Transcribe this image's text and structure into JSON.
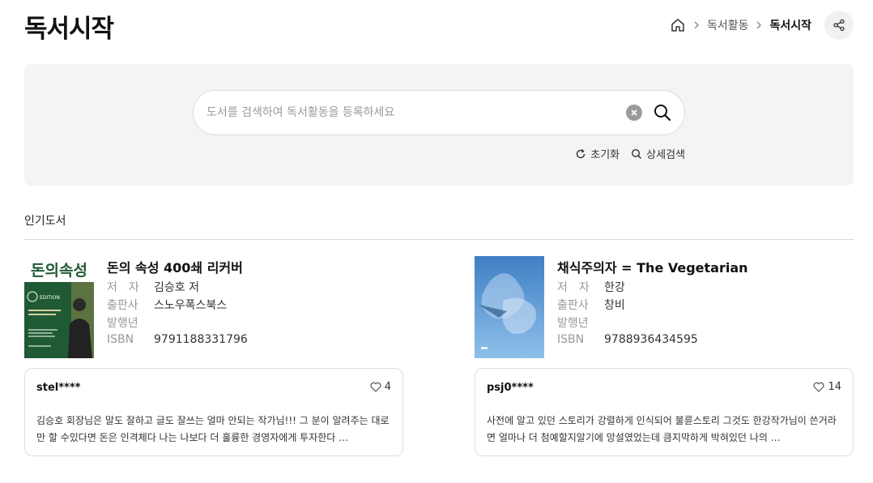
{
  "header": {
    "title": "독서시작",
    "breadcrumb": [
      "독서활동",
      "독서시작"
    ],
    "home_icon": "home-icon",
    "share_icon": "share-icon"
  },
  "search": {
    "placeholder": "도서를 검색하여 독서활동을 등록하세요",
    "value": "",
    "reset_label": "초기화",
    "advanced_label": "상세검색"
  },
  "section": {
    "title": "인기도서"
  },
  "labels": {
    "author": "저　자",
    "publisher": "출판사",
    "year": "발행년",
    "isbn": "ISBN"
  },
  "books": [
    {
      "title": "돈의 속성 400쇄 리커버",
      "author": "김승호 저",
      "publisher": "스노우폭스북스",
      "year": "",
      "isbn": "9791188331796",
      "cover_title": "돈의속성",
      "cover_edition": "EDITION",
      "cover_colors": {
        "top": "#ffffff",
        "bottom": "#1f5a34",
        "title": "#1f5a34"
      },
      "review": {
        "user": "stel****",
        "likes": "4",
        "text": "김승호 회장님은 말도 잘하고 글도 잘쓰는 얼마 안되는 작가님!!! 그 분이 알려주는 대로만 할 수있다면 돈은 인격체다 나는 나보다 더 훌륭한 경영자에게 투자한다 …"
      }
    },
    {
      "title": "채식주의자 = The Vegetarian",
      "author": "한강",
      "publisher": "창비",
      "year": "",
      "isbn": "9788936434595",
      "cover_colors": {
        "top": "#3f7fc4",
        "bottom": "#8fc0ea"
      },
      "review": {
        "user": "psj0****",
        "likes": "14",
        "text": "사전에 알고 있던 스토리가 강렬하게 인식되어 불륜스토리 그것도 한강작가님이 쓴거라면 얼마나 더 첨예할지알기에 망설였었는데 큼지막하게 박혀있던 나의 …"
      }
    }
  ]
}
